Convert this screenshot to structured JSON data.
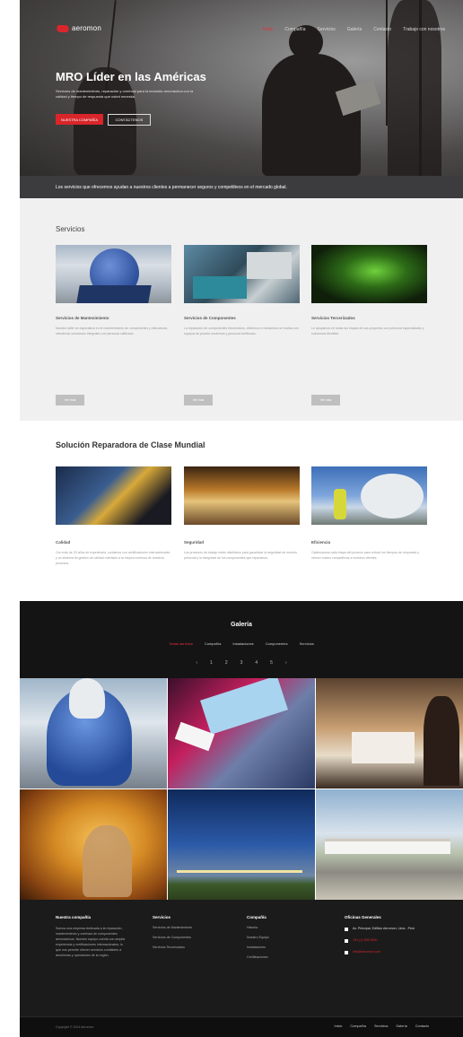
{
  "brand": {
    "name": "aeromon",
    "accent": "#d8262b"
  },
  "nav": {
    "items": [
      "Inicio",
      "Compañía",
      "Servicios",
      "Galería",
      "Contacto",
      "Trabaje con nosotros"
    ],
    "active_index": 0
  },
  "hero": {
    "title": "MRO Líder en las Américas",
    "subtitle": "Servicios de mantenimiento, reparación y overhaul para la industria aeronáutica con la calidad y tiempo de respuesta que usted necesita.",
    "primary_button": "NUESTRA COMPAÑÍA",
    "secondary_button": "CONTÁCTENOS",
    "caption": "Los servicios que ofrecemos ayudan a nuestros clientes a permanecer seguros y competitivos en el mercado global."
  },
  "services": {
    "title": "Servicios",
    "cards": [
      {
        "title": "Servicios de Mantenimiento",
        "text": "Nuestro taller se especializa en el mantenimiento de componentes y estructuras, ofreciendo soluciones integrales con personal calificado.",
        "more": "Ver más"
      },
      {
        "title": "Servicios de Componentes",
        "text": "La reparación de componentes electrónicos, eléctricos e hidráulicos se realiza con equipos de prueba modernos y personal certificado.",
        "more": "Ver más"
      },
      {
        "title": "Servicios Tercerizados",
        "text": "Le apoyamos en todas las etapas de sus proyectos con personal especializado y soluciones flexibles.",
        "more": "Ver más"
      }
    ]
  },
  "solution": {
    "title": "Solución Reparadora de Clase Mundial",
    "cards": [
      {
        "title": "Calidad",
        "text": "Con más de 20 años de experiencia, contamos con certificaciones internacionales y un sistema de gestión de calidad orientado a la mejora continua de nuestros procesos."
      },
      {
        "title": "Seguridad",
        "text": "Los procesos de trabajo están diseñados para garantizar la seguridad de nuestro personal y la integridad de los componentes que reparamos."
      },
      {
        "title": "Eficiencia",
        "text": "Optimizamos cada etapa del proceso para reducir los tiempos de respuesta y ofrecer costos competitivos a nuestros clientes."
      }
    ]
  },
  "gallery": {
    "title": "Galería",
    "filters": [
      "Todas las fotos",
      "Compañía",
      "Instalaciones",
      "Componentes",
      "Servicios"
    ],
    "active_filter": 0,
    "pager": [
      "‹",
      "1",
      "2",
      "3",
      "4",
      "5",
      "›"
    ]
  },
  "footer": {
    "about": {
      "title": "Nuestra compañía",
      "text": "Somos una empresa dedicada a la reparación, mantenimiento y overhaul de componentes aeronáuticos. Nuestro equipo cuenta con amplia experiencia y certificaciones internacionales, lo que nos permite ofrecer servicios confiables a aerolíneas y operadores de la región."
    },
    "services": {
      "title": "Servicios",
      "items": [
        "Servicios de Mantenimiento",
        "Servicios de Componentes",
        "Servicios Tercerizados"
      ]
    },
    "company": {
      "title": "Compañía",
      "items": [
        "Historia",
        "Nuestro Equipo",
        "Instalaciones",
        "Certificaciones"
      ]
    },
    "offices": {
      "title": "Oficinas Generales",
      "address": "Av. Principal, Edificio Aeromon, Lima - Perú",
      "phone": "+51 (1) 555 0000",
      "email": "info@aeromon.com"
    },
    "copyright": "Copyright © 2014 Aeromon",
    "bottom_links": [
      "Inicio",
      "Compañía",
      "Servicios",
      "Galería",
      "Contacto"
    ]
  }
}
